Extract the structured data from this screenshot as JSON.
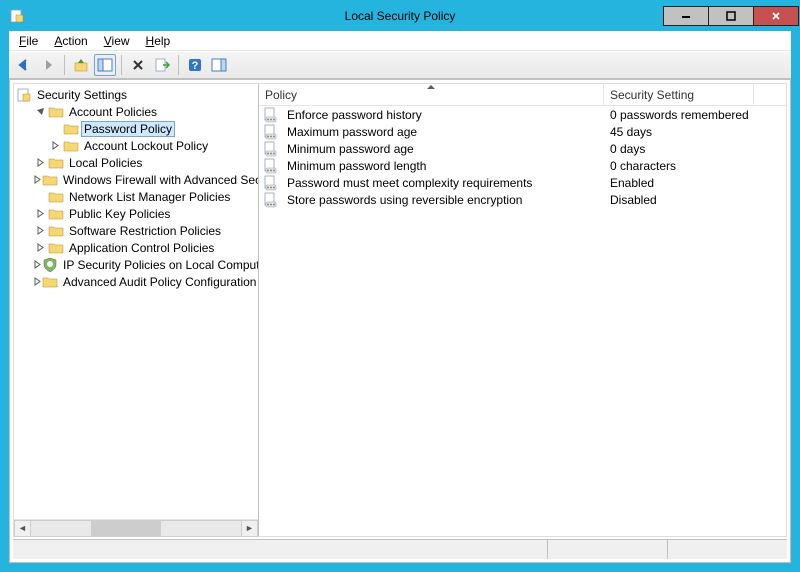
{
  "window": {
    "title": "Local Security Policy"
  },
  "menu": {
    "file": "File",
    "action": "Action",
    "view": "View",
    "help": "Help",
    "file_u": "F",
    "action_u": "A",
    "view_u": "V",
    "help_u": "H"
  },
  "tree": {
    "root": "Security Settings",
    "items": [
      {
        "label": "Account Policies",
        "expanded": true,
        "depth": 1,
        "hasChildren": true
      },
      {
        "label": "Password Policy",
        "expanded": false,
        "depth": 2,
        "hasChildren": false,
        "selected": true
      },
      {
        "label": "Account Lockout Policy",
        "expanded": false,
        "depth": 2,
        "hasChildren": true
      },
      {
        "label": "Local Policies",
        "expanded": false,
        "depth": 1,
        "hasChildren": true
      },
      {
        "label": "Windows Firewall with Advanced Security",
        "expanded": false,
        "depth": 1,
        "hasChildren": true
      },
      {
        "label": "Network List Manager Policies",
        "expanded": false,
        "depth": 1,
        "hasChildren": false
      },
      {
        "label": "Public Key Policies",
        "expanded": false,
        "depth": 1,
        "hasChildren": true
      },
      {
        "label": "Software Restriction Policies",
        "expanded": false,
        "depth": 1,
        "hasChildren": true
      },
      {
        "label": "Application Control Policies",
        "expanded": false,
        "depth": 1,
        "hasChildren": true
      },
      {
        "label": "IP Security Policies on Local Computer",
        "expanded": false,
        "depth": 1,
        "hasChildren": true,
        "icon": "shield"
      },
      {
        "label": "Advanced Audit Policy Configuration",
        "expanded": false,
        "depth": 1,
        "hasChildren": true
      }
    ]
  },
  "list": {
    "columns": {
      "policy": "Policy",
      "setting": "Security Setting"
    },
    "col_widths": {
      "policy": 345,
      "setting": 160
    },
    "rows": [
      {
        "policy": "Enforce password history",
        "setting": "0 passwords remembered"
      },
      {
        "policy": "Maximum password age",
        "setting": "45 days"
      },
      {
        "policy": "Minimum password age",
        "setting": "0 days"
      },
      {
        "policy": "Minimum password length",
        "setting": "0 characters"
      },
      {
        "policy": "Password must meet complexity requirements",
        "setting": "Enabled"
      },
      {
        "policy": "Store passwords using reversible encryption",
        "setting": "Disabled"
      }
    ]
  },
  "toolbar_icons": [
    "back",
    "forward",
    "sep",
    "up",
    "show-hide-tree",
    "sep",
    "delete",
    "refresh",
    "sep",
    "help",
    "show-hide-action"
  ]
}
